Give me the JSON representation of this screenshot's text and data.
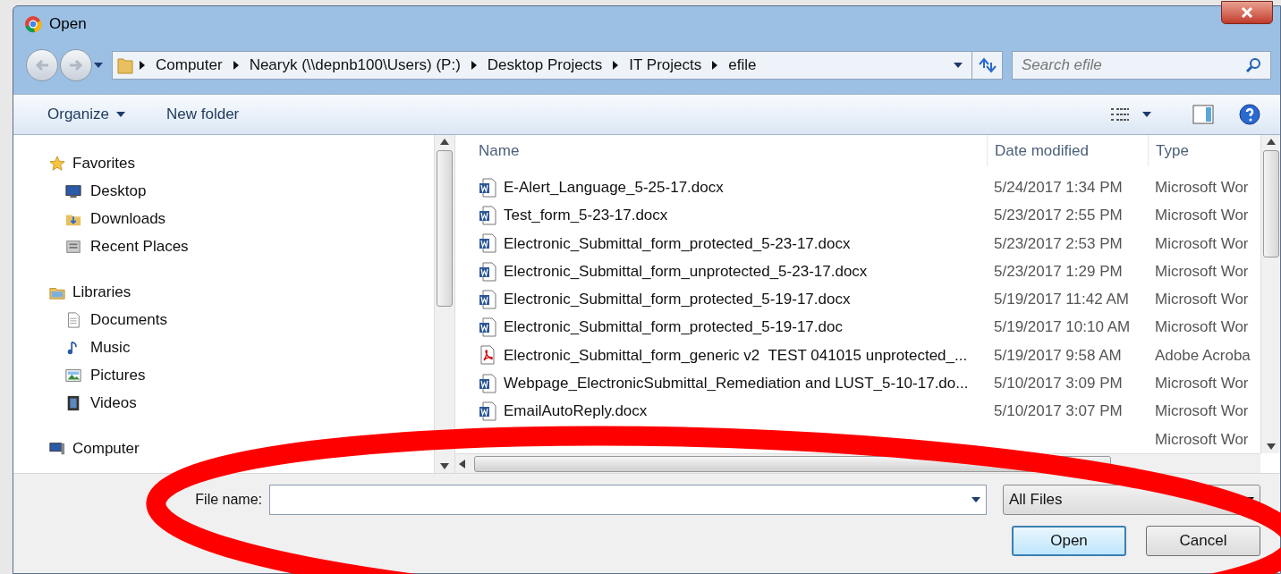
{
  "window": {
    "title": "Open"
  },
  "address_bar": {
    "segments": [
      "Computer",
      "Nearyk (\\\\depnb100\\Users) (P:)",
      "Desktop Projects",
      "IT Projects",
      "efile"
    ]
  },
  "search": {
    "placeholder": "Search efile"
  },
  "toolbar": {
    "organize": "Organize",
    "new_folder": "New folder"
  },
  "nav": [
    {
      "label": "Favorites",
      "kind": "star",
      "children": [
        {
          "label": "Desktop",
          "kind": "desktop"
        },
        {
          "label": "Downloads",
          "kind": "downloads"
        },
        {
          "label": "Recent Places",
          "kind": "recent"
        }
      ]
    },
    {
      "label": "Libraries",
      "kind": "library",
      "children": [
        {
          "label": "Documents",
          "kind": "documents"
        },
        {
          "label": "Music",
          "kind": "music"
        },
        {
          "label": "Pictures",
          "kind": "pictures"
        },
        {
          "label": "Videos",
          "kind": "videos"
        }
      ]
    },
    {
      "label": "Computer",
      "kind": "computer"
    }
  ],
  "columns": [
    "Name",
    "Date modified",
    "Type"
  ],
  "files": [
    {
      "name": "E-Alert_Language_5-25-17.docx",
      "date": "5/24/2017 1:34 PM",
      "type": "Microsoft Wor",
      "kind": "word"
    },
    {
      "name": "Test_form_5-23-17.docx",
      "date": "5/23/2017 2:55 PM",
      "type": "Microsoft Wor",
      "kind": "word"
    },
    {
      "name": "Electronic_Submittal_form_protected_5-23-17.docx",
      "date": "5/23/2017 2:53 PM",
      "type": "Microsoft Wor",
      "kind": "word"
    },
    {
      "name": "Electronic_Submittal_form_unprotected_5-23-17.docx",
      "date": "5/23/2017 1:29 PM",
      "type": "Microsoft Wor",
      "kind": "word"
    },
    {
      "name": "Electronic_Submittal_form_protected_5-19-17.docx",
      "date": "5/19/2017 11:42 AM",
      "type": "Microsoft Wor",
      "kind": "word"
    },
    {
      "name": "Electronic_Submittal_form_protected_5-19-17.doc",
      "date": "5/19/2017 10:10 AM",
      "type": "Microsoft Wor",
      "kind": "word"
    },
    {
      "name": "Electronic_Submittal_form_generic v2  TEST 041015 unprotected_...",
      "date": "5/19/2017 9:58 AM",
      "type": "Adobe Acroba",
      "kind": "pdf"
    },
    {
      "name": "Webpage_ElectronicSubmittal_Remediation and LUST_5-10-17.do...",
      "date": "5/10/2017 3:09 PM",
      "type": "Microsoft Wor",
      "kind": "word"
    },
    {
      "name": "EmailAutoReply.docx",
      "date": "5/10/2017 3:07 PM",
      "type": "Microsoft Wor",
      "kind": "word"
    },
    {
      "type": "Microsoft Wor"
    }
  ],
  "footer": {
    "file_name_label": "File name:",
    "filter": "All Files",
    "open": "Open",
    "cancel": "Cancel"
  }
}
